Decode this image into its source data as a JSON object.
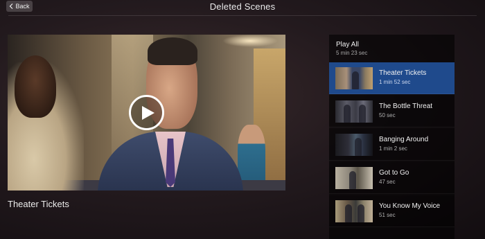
{
  "header": {
    "back_label": "Back",
    "title": "Deleted Scenes"
  },
  "player": {
    "caption": "Theater Tickets"
  },
  "playlist": {
    "play_all_label": "Play All",
    "play_all_duration": "5 min 23 sec",
    "scenes": [
      {
        "title": "Theater Tickets",
        "duration": "1 min 52 sec",
        "active": true
      },
      {
        "title": "The Bottle Threat",
        "duration": "50 sec",
        "active": false
      },
      {
        "title": "Banging Around",
        "duration": "1 min 2 sec",
        "active": false
      },
      {
        "title": "Got to Go",
        "duration": "47 sec",
        "active": false
      },
      {
        "title": "You Know My Voice",
        "duration": "51 sec",
        "active": false
      }
    ]
  },
  "colors": {
    "accent": "#1f4a8c",
    "panel_background": "#000000"
  }
}
